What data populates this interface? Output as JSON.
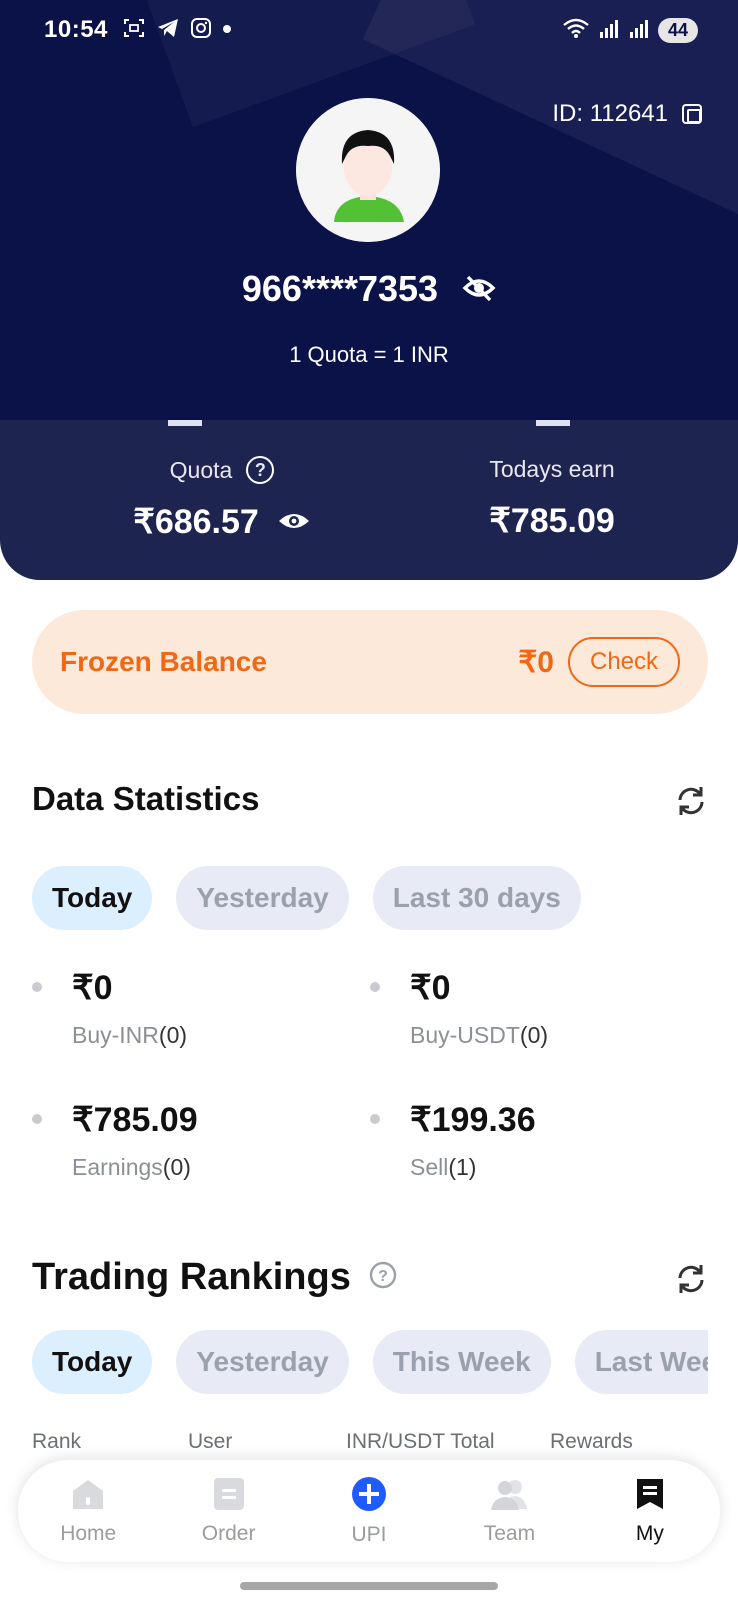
{
  "status_bar": {
    "time": "10:54",
    "battery": "44"
  },
  "profile": {
    "id_label": "ID: 112641",
    "phone": "966****7353",
    "quota_rate": "1 Quota = 1 INR"
  },
  "stats": {
    "quota_label": "Quota",
    "quota_value": "₹686.57",
    "today_earn_label": "Todays earn",
    "today_earn_value": "₹785.09"
  },
  "frozen": {
    "title": "Frozen Balance",
    "amount": "₹0",
    "check_label": "Check"
  },
  "data_statistics": {
    "title": "Data Statistics",
    "tabs": [
      {
        "label": "Today",
        "active": true
      },
      {
        "label": "Yesterday",
        "active": false
      },
      {
        "label": "Last 30 days",
        "active": false
      }
    ],
    "metrics": [
      {
        "value": "₹0",
        "label": "Buy-INR",
        "count": "(0)"
      },
      {
        "value": "₹0",
        "label": "Buy-USDT",
        "count": "(0)"
      },
      {
        "value": "₹785.09",
        "label": "Earnings",
        "count": "(0)"
      },
      {
        "value": "₹199.36",
        "label": "Sell",
        "count": "(1)"
      }
    ]
  },
  "trading_rankings": {
    "title": "Trading Rankings",
    "tabs": [
      {
        "label": "Today",
        "active": true
      },
      {
        "label": "Yesterday",
        "active": false
      },
      {
        "label": "This Week",
        "active": false
      },
      {
        "label": "Last Week",
        "active": false
      }
    ],
    "columns": [
      "Rank",
      "User",
      "INR/USDT Total",
      "Rewards"
    ]
  },
  "nav": {
    "items": [
      {
        "label": "Home",
        "icon": "home-icon"
      },
      {
        "label": "Order",
        "icon": "order-icon"
      },
      {
        "label": "UPI",
        "icon": "plus-circle-icon"
      },
      {
        "label": "Team",
        "icon": "team-icon"
      },
      {
        "label": "My",
        "icon": "bookmark-icon"
      }
    ],
    "active": "My"
  },
  "colors": {
    "header_bg": "#0b1248",
    "card_bg": "#1d2450",
    "accent_orange": "#f06814",
    "frozen_bg": "#fde9da",
    "upi_blue": "#1f5bff"
  }
}
